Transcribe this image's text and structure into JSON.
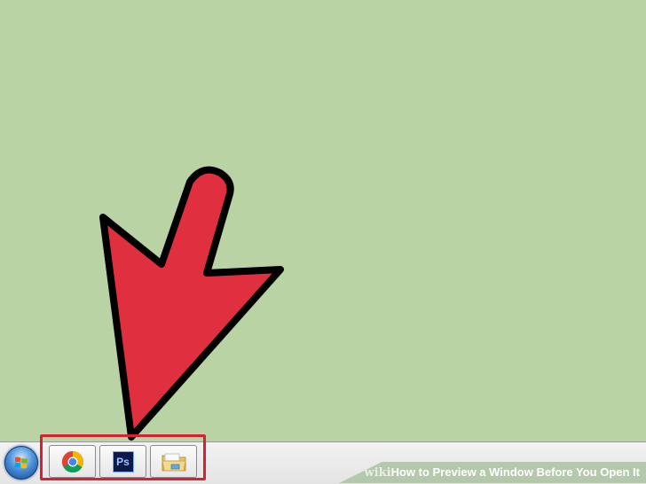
{
  "desktop": {
    "background_color": "#b9d3a5"
  },
  "annotation": {
    "arrow_color": "#e03040",
    "highlight_color": "#d42232"
  },
  "taskbar": {
    "start_button": {
      "icon": "windows-logo-icon"
    },
    "pinned_apps": [
      {
        "name": "Google Chrome",
        "icon": "chrome-icon"
      },
      {
        "name": "Adobe Photoshop",
        "icon": "photoshop-icon",
        "icon_text": "Ps"
      },
      {
        "name": "Windows Explorer",
        "icon": "folder-icon"
      }
    ]
  },
  "watermark": {
    "brand": "wiki",
    "title": "How to Preview a Window Before You Open It"
  }
}
